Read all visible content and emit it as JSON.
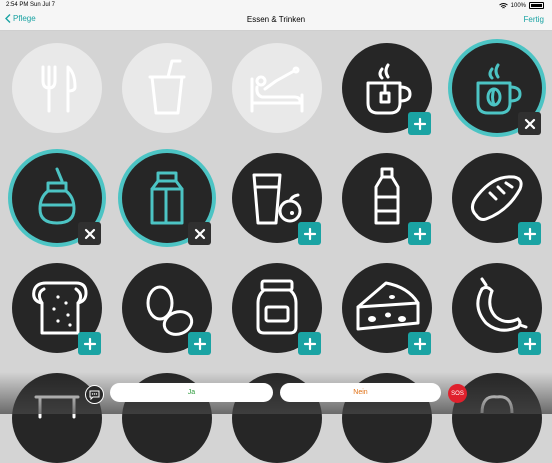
{
  "status": {
    "time": "2:54 PM",
    "date": "Sun Jul 7",
    "battery": "100%"
  },
  "nav": {
    "back_label": "Pflege",
    "title": "Essen & Trinken",
    "done_label": "Fertig"
  },
  "colors": {
    "accent": "#1aa3a3",
    "selected_ring": "#4cc4c4",
    "tile_dark": "#262626",
    "tile_light": "#e9e9e9",
    "sos": "#e0202c",
    "yes_text": "#2b9a3a",
    "no_text": "#e07014"
  },
  "tiles": [
    {
      "icon": "fork-knife-icon",
      "style": "light",
      "badge": "none"
    },
    {
      "icon": "drink-cup-straw-icon",
      "style": "light",
      "badge": "none"
    },
    {
      "icon": "bed-feeding-icon",
      "style": "light",
      "badge": "none"
    },
    {
      "icon": "tea-cup-icon",
      "style": "dark",
      "badge": "add"
    },
    {
      "icon": "coffee-cup-icon",
      "style": "dark-selected",
      "badge": "remove"
    },
    {
      "icon": "sugar-dispenser-icon",
      "style": "dark-selected",
      "badge": "remove"
    },
    {
      "icon": "milk-carton-icon",
      "style": "dark-selected",
      "badge": "remove"
    },
    {
      "icon": "juice-glass-orange-icon",
      "style": "dark",
      "badge": "add"
    },
    {
      "icon": "water-bottle-icon",
      "style": "dark",
      "badge": "add"
    },
    {
      "icon": "bread-loaf-icon",
      "style": "dark",
      "badge": "add"
    },
    {
      "icon": "toast-slice-icon",
      "style": "dark",
      "badge": "add"
    },
    {
      "icon": "eggs-icon",
      "style": "dark",
      "badge": "add"
    },
    {
      "icon": "jam-jar-icon",
      "style": "dark",
      "badge": "add"
    },
    {
      "icon": "cheese-icon",
      "style": "dark",
      "badge": "add"
    },
    {
      "icon": "sausage-icon",
      "style": "dark",
      "badge": "add"
    }
  ],
  "bottom": {
    "yes_label": "Ja",
    "no_label": "Nein",
    "sos_label": "SOS"
  }
}
